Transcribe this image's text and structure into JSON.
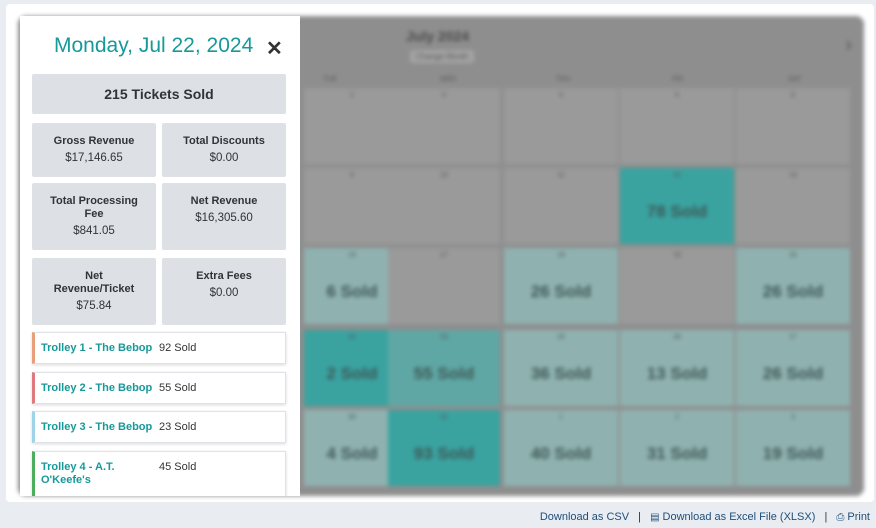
{
  "modal": {
    "date": "Monday, Jul 22, 2024",
    "close": "✕",
    "tickets_sold": "215 Tickets Sold",
    "stats": [
      {
        "label": "Gross Revenue",
        "value": "$17,146.65"
      },
      {
        "label": "Total Discounts",
        "value": "$0.00"
      },
      {
        "label": "Total Processing Fee",
        "value": "$841.05"
      },
      {
        "label": "Net Revenue",
        "value": "$16,305.60"
      },
      {
        "label": "Net Revenue/Ticket",
        "value": "$75.84"
      },
      {
        "label": "Extra Fees",
        "value": "$0.00"
      }
    ],
    "trolleys": [
      {
        "name": "Trolley 1 - The Bebop",
        "sold": "92 Sold",
        "color": "#e8a07a"
      },
      {
        "name": "Trolley 2 - The Bebop",
        "sold": "55 Sold",
        "color": "#e0787f"
      },
      {
        "name": "Trolley 3 - The Bebop",
        "sold": "23 Sold",
        "color": "#9fd3ea"
      },
      {
        "name": "Trolley 4 - A.T. O'Keefe's",
        "sold": "45 Sold",
        "color": "#4cae5c"
      }
    ]
  },
  "calendar": {
    "month": "July 2024",
    "change_month": "Change Month",
    "next": "›",
    "days_of_week": [
      "TUE",
      "WED",
      "THU",
      "FRI",
      "SAT"
    ],
    "rows": [
      [
        {
          "num": "2",
          "sold": ""
        },
        {
          "num": "3",
          "sold": ""
        },
        {
          "num": "4",
          "sold": ""
        },
        {
          "num": "5",
          "sold": ""
        },
        {
          "num": "6",
          "sold": ""
        }
      ],
      [
        {
          "num": "9",
          "sold": ""
        },
        {
          "num": "10",
          "sold": ""
        },
        {
          "num": "11",
          "sold": ""
        },
        {
          "num": "12",
          "sold": "78 Sold"
        },
        {
          "num": "13",
          "sold": ""
        }
      ],
      [
        {
          "num": "16",
          "sold": "6 Sold"
        },
        {
          "num": "17",
          "sold": ""
        },
        {
          "num": "18",
          "sold": "26 Sold"
        },
        {
          "num": "19",
          "sold": ""
        },
        {
          "num": "20",
          "sold": "26 Sold"
        }
      ],
      [
        {
          "num": "23",
          "sold": "2 Sold"
        },
        {
          "num": "24",
          "sold": "55 Sold"
        },
        {
          "num": "25",
          "sold": "36 Sold"
        },
        {
          "num": "26",
          "sold": "13 Sold"
        },
        {
          "num": "27",
          "sold": "26 Sold"
        }
      ],
      [
        {
          "num": "30",
          "sold": "4 Sold"
        },
        {
          "num": "31",
          "sold": "93 Sold"
        },
        {
          "num": "1",
          "sold": "40 Sold"
        },
        {
          "num": "2",
          "sold": "31 Sold"
        },
        {
          "num": "3",
          "sold": "19 Sold"
        }
      ]
    ]
  },
  "footer": {
    "csv": "Download as CSV",
    "xlsx": "Download as Excel File (XLSX)",
    "print": "Print",
    "sep": "|",
    "xlsx_icon": "file-excel-icon",
    "print_icon": "printer-icon"
  }
}
